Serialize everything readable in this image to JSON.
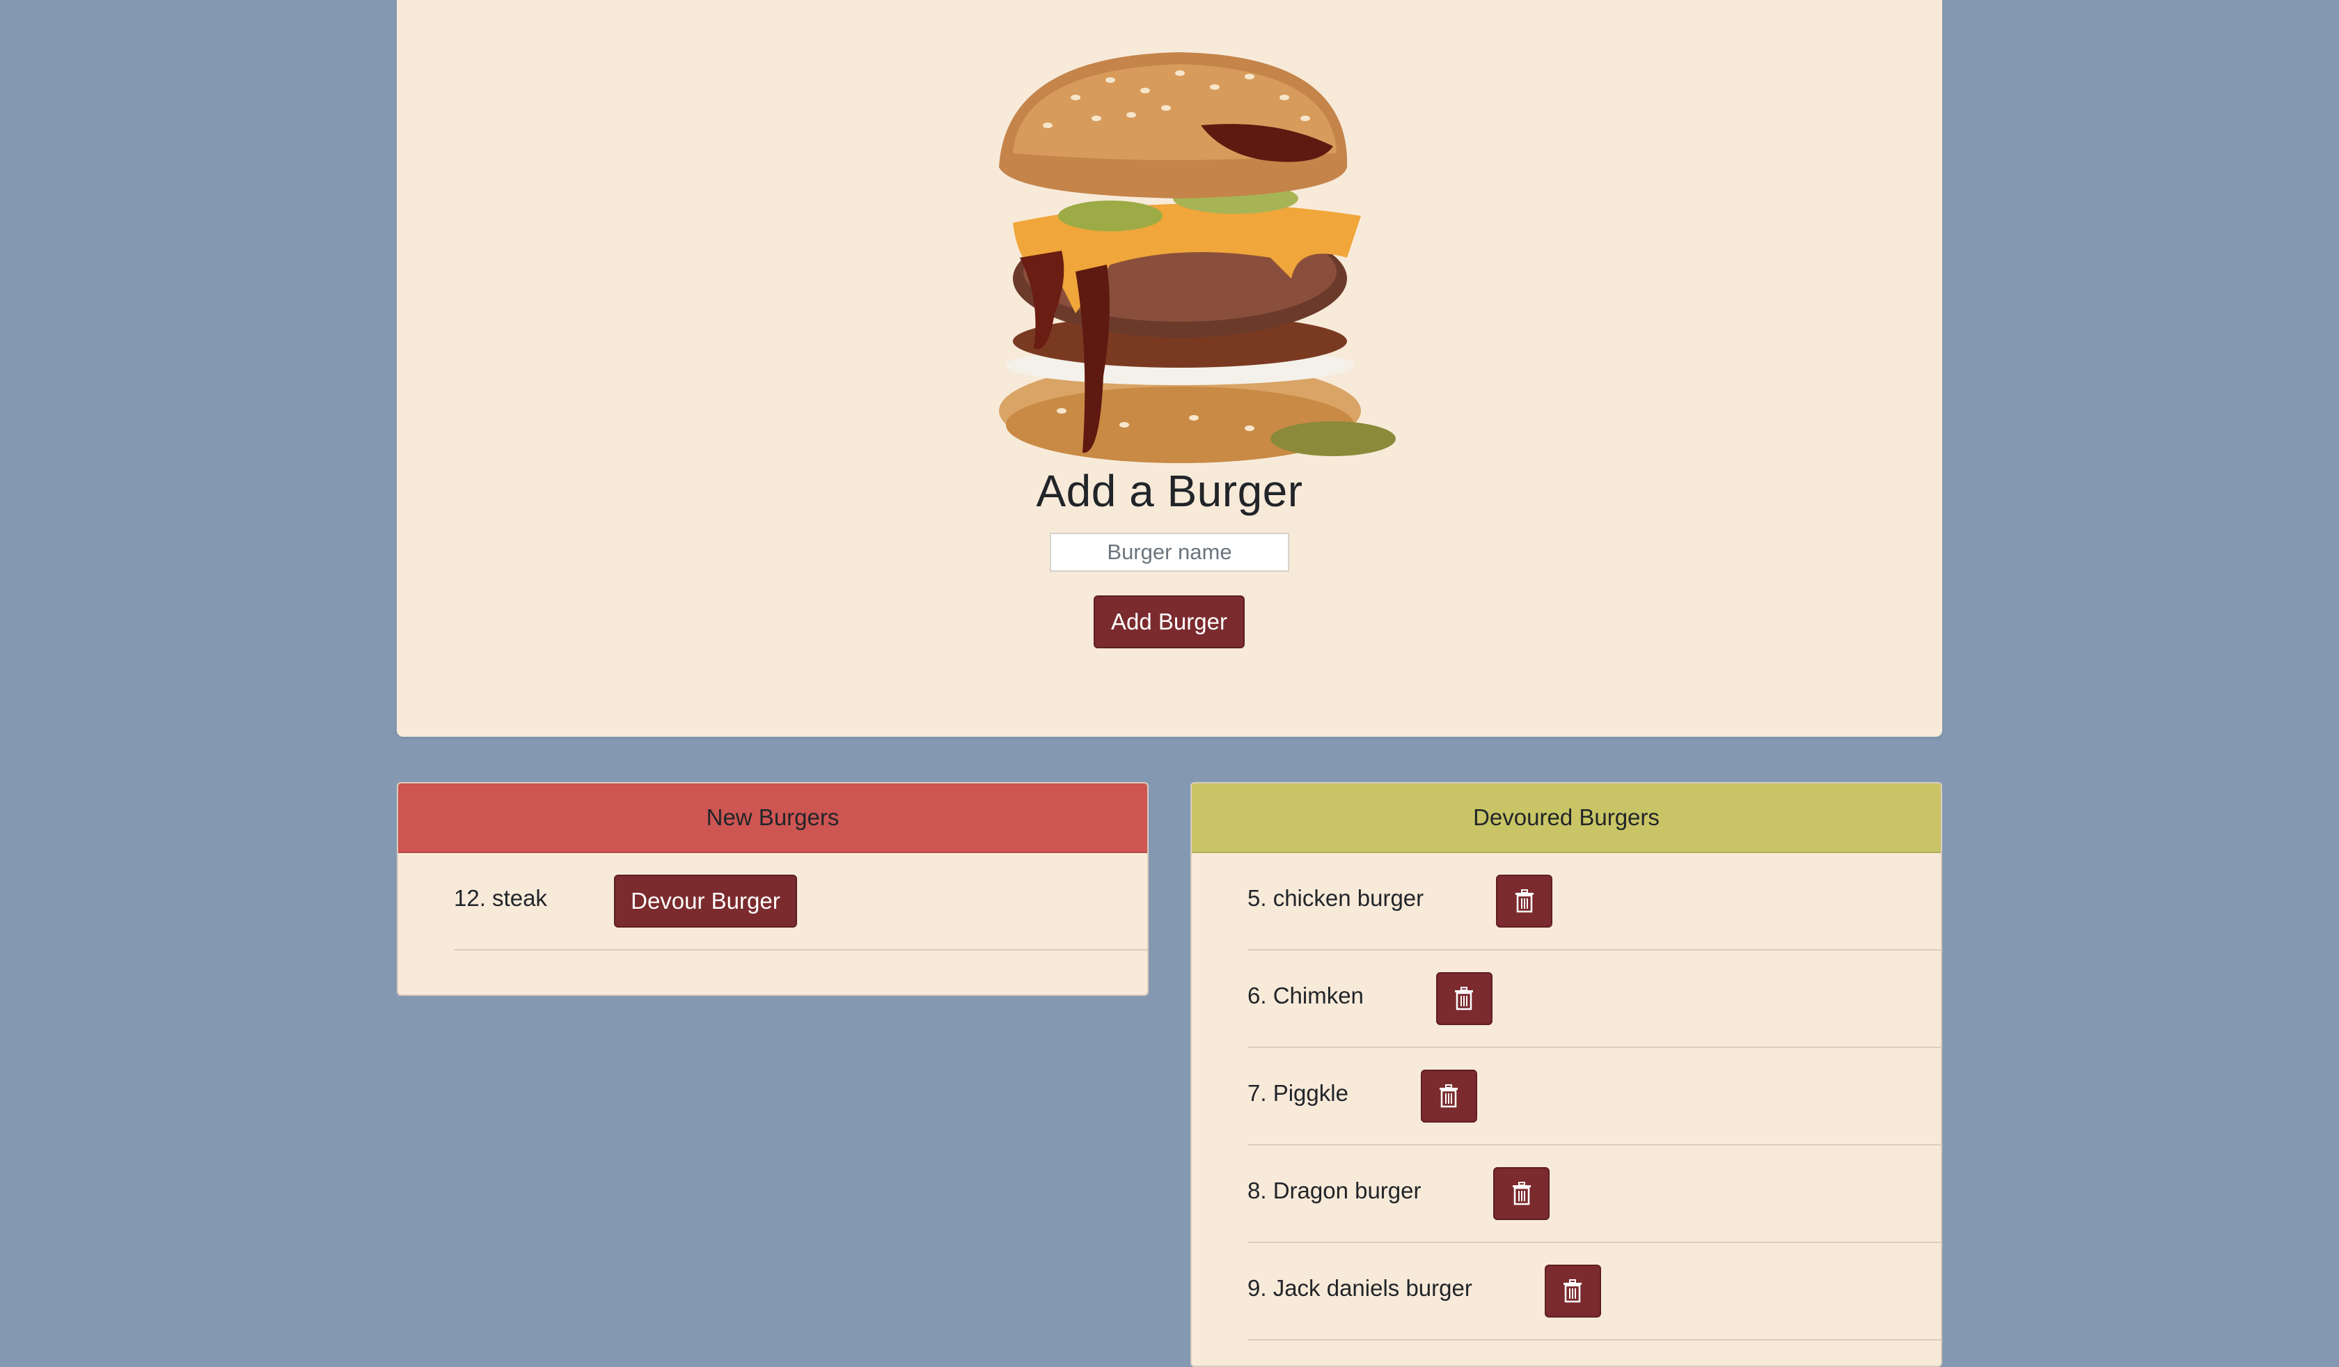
{
  "form": {
    "heading": "Add a Burger",
    "input_placeholder": "Burger name",
    "input_value": "",
    "add_button_label": "Add Burger"
  },
  "new_burgers": {
    "header": "New Burgers",
    "items": [
      {
        "label": "12. steak",
        "button_label": "Devour Burger"
      }
    ]
  },
  "devoured_burgers": {
    "header": "Devoured Burgers",
    "items": [
      {
        "label": "5. chicken burger",
        "button_icon": "trash-icon"
      },
      {
        "label": "6. Chimken",
        "button_icon": "trash-icon"
      },
      {
        "label": "7. Piggkle",
        "button_icon": "trash-icon"
      },
      {
        "label": "8. Dragon burger",
        "button_icon": "trash-icon"
      },
      {
        "label": "9. Jack daniels burger",
        "button_icon": "trash-icon"
      }
    ]
  },
  "colors": {
    "page_background": "#8499b1",
    "panel_background": "#f8ead9",
    "button_background": "#7b2b2e",
    "new_header": "#cd5552",
    "devoured_header": "#c9c566"
  }
}
